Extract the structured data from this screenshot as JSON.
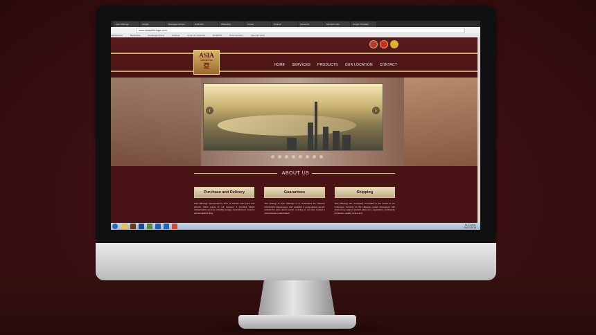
{
  "browser": {
    "tabs": [
      "Asia Offerings",
      "Google",
      "Estrategia Chinos",
      "Colombia",
      "WhatsApp",
      "Correo",
      "Outlook",
      "Facebook",
      "Mercado Libre",
      "Google Translate"
    ],
    "url": "www.asiaofferings.com",
    "bookmarks": [
      "Aplicaciones",
      "Bookmarks",
      "Estrategia Chinos",
      "Gráficos",
      "Curso de Cantonés",
      "DIVERSO",
      "Para Carrefour",
      "Aprender chino"
    ]
  },
  "site": {
    "language_flags": [
      {
        "name": "us-flag-icon",
        "color": "#b33a3a"
      },
      {
        "name": "china-flag-icon",
        "color": "#d02a1e"
      },
      {
        "name": "spain-flag-icon",
        "color": "#e0b020"
      }
    ],
    "logo": {
      "title": "ASIA",
      "subtitle": "OFFERINGS",
      "mark": "亞"
    },
    "nav": [
      "HOME",
      "SERVICES",
      "PRODUCTS",
      "OUR LOCATION",
      "CONTACT"
    ],
    "carousel": {
      "prev_icon": "‹",
      "next_icon": "›",
      "dots": 8
    },
    "about_title": "ABOUT US",
    "cards": [
      {
        "label": "Purchase and Delivery",
        "text": "Asia Offerings represented by W.S. of China's main ports and airports which points to our success, it provides freight transportation services including storage, transshipment, customs arrival manifest filing."
      },
      {
        "label": "Guarantees",
        "text": "The strategy of Asia Offerings is to understand the Chinese economical phenomenon and establish a personalized service portfolio for each client's needs. In doing so, we have created a new business model based."
      },
      {
        "label": "Shipping",
        "text": "Asia Offerings are completely committed to the needs of our customers, focusing on the Hispanic market themselves with determining support product placement, negotiation, purchasing, production, quality control and."
      }
    ]
  },
  "taskbar": {
    "time": "11:21 a.m.",
    "date": "01/07/2015",
    "apps": [
      {
        "name": "explorer-icon",
        "color": "#e6c24a"
      },
      {
        "name": "illustrator-icon",
        "color": "#6a3a10"
      },
      {
        "name": "photoshop-icon",
        "color": "#1a4a8a"
      },
      {
        "name": "media-icon",
        "color": "#5a8a3a"
      },
      {
        "name": "word-icon",
        "color": "#2a5aaa"
      },
      {
        "name": "outlook-icon",
        "color": "#1a6ab0"
      },
      {
        "name": "chrome-icon",
        "color": "#d04a3a"
      }
    ]
  }
}
